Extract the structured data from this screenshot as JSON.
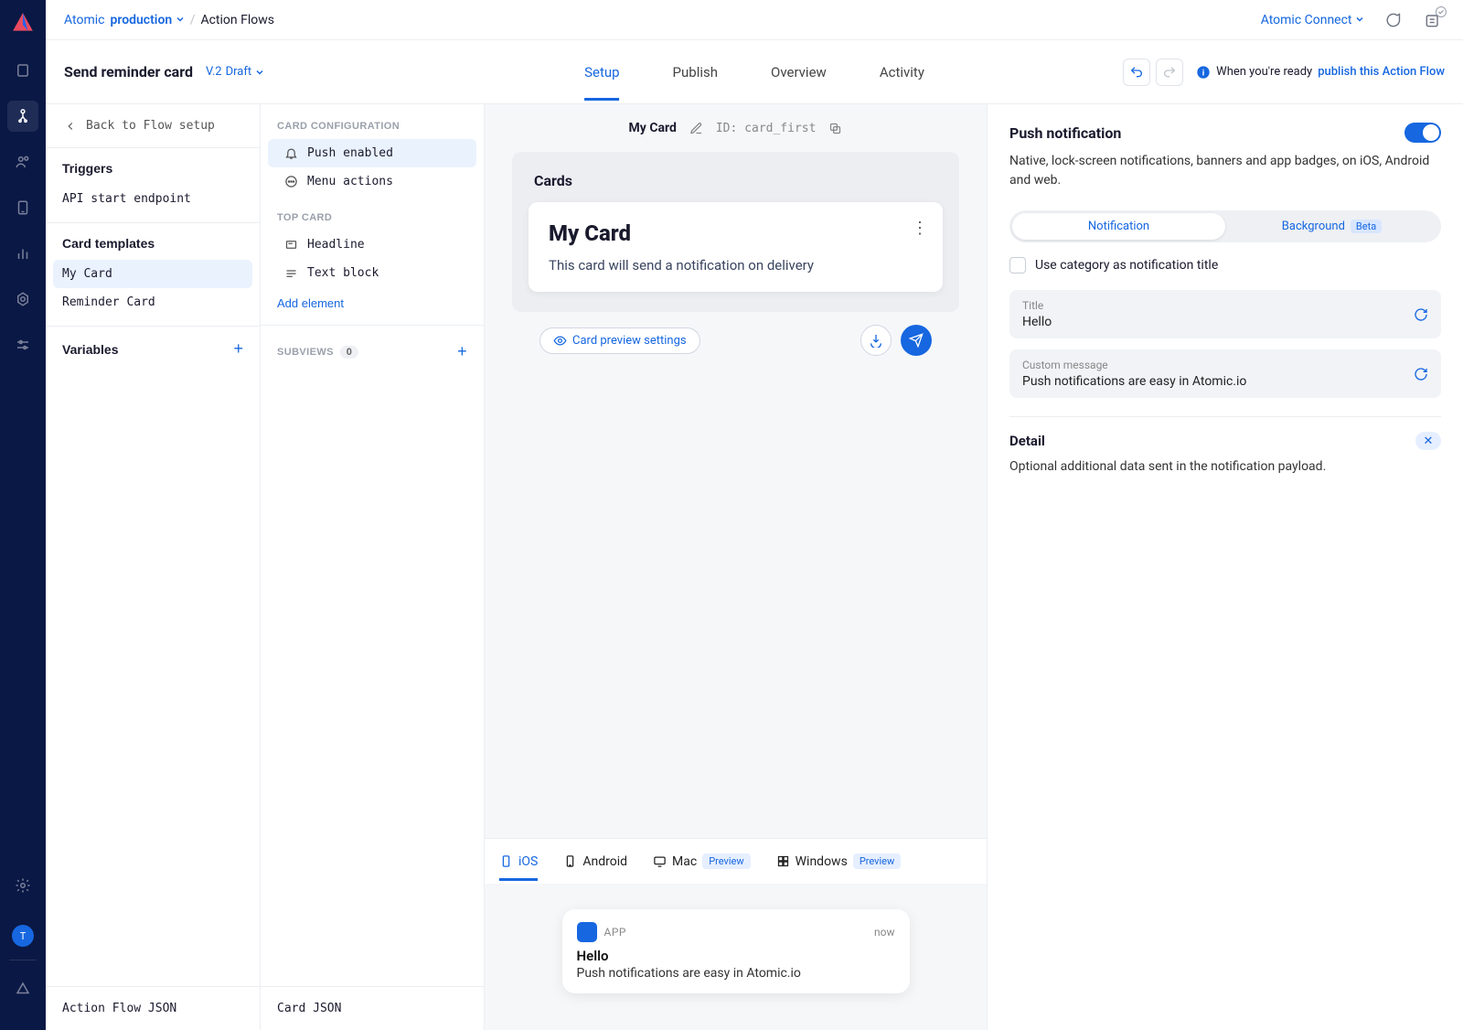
{
  "header": {
    "org": "Atomic",
    "env": "production",
    "breadcrumb": "Action Flows",
    "connect": "Atomic Connect"
  },
  "subheader": {
    "title": "Send reminder card",
    "version": "V.2",
    "status": "Draft",
    "tabs": [
      "Setup",
      "Publish",
      "Overview",
      "Activity"
    ],
    "hint_prefix": "When you're ready",
    "hint_link": "publish this Action Flow"
  },
  "col1": {
    "back": "Back to Flow setup",
    "triggers": {
      "title": "Triggers",
      "items": [
        "API start endpoint"
      ]
    },
    "templates": {
      "title": "Card templates",
      "items": [
        "My Card",
        "Reminder Card"
      ]
    },
    "variables": "Variables",
    "footer": "Action Flow JSON"
  },
  "col2": {
    "config_label": "CARD CONFIGURATION",
    "config_items": [
      "Push enabled",
      "Menu actions"
    ],
    "topcard_label": "TOP CARD",
    "topcard_items": [
      "Headline",
      "Text block"
    ],
    "add": "Add element",
    "subviews_label": "SUBVIEWS",
    "subviews_count": "0",
    "footer": "Card JSON"
  },
  "canvas": {
    "title": "My Card",
    "id_label": "ID:",
    "id": "card_first",
    "cards_label": "Cards",
    "card_title": "My Card",
    "card_body": "This card will send a notification on delivery",
    "preview_settings": "Card preview settings"
  },
  "platforms": {
    "items": [
      "iOS",
      "Android",
      "Mac",
      "Windows"
    ],
    "preview_badge": "Preview"
  },
  "notif": {
    "app": "APP",
    "time": "now",
    "title": "Hello",
    "body": "Push notifications are easy in Atomic.io"
  },
  "panel": {
    "title": "Push notification",
    "desc": "Native, lock-screen notifications, banners and app badges, on iOS, Android and web.",
    "seg": [
      "Notification",
      "Background"
    ],
    "beta": "Beta",
    "check": "Use category as notification title",
    "field1_label": "Title",
    "field1_val": "Hello",
    "field2_label": "Custom message",
    "field2_val": "Push notifications are easy in Atomic.io",
    "detail_title": "Detail",
    "detail_desc": "Optional additional data sent in the notification payload."
  },
  "avatar": "T"
}
